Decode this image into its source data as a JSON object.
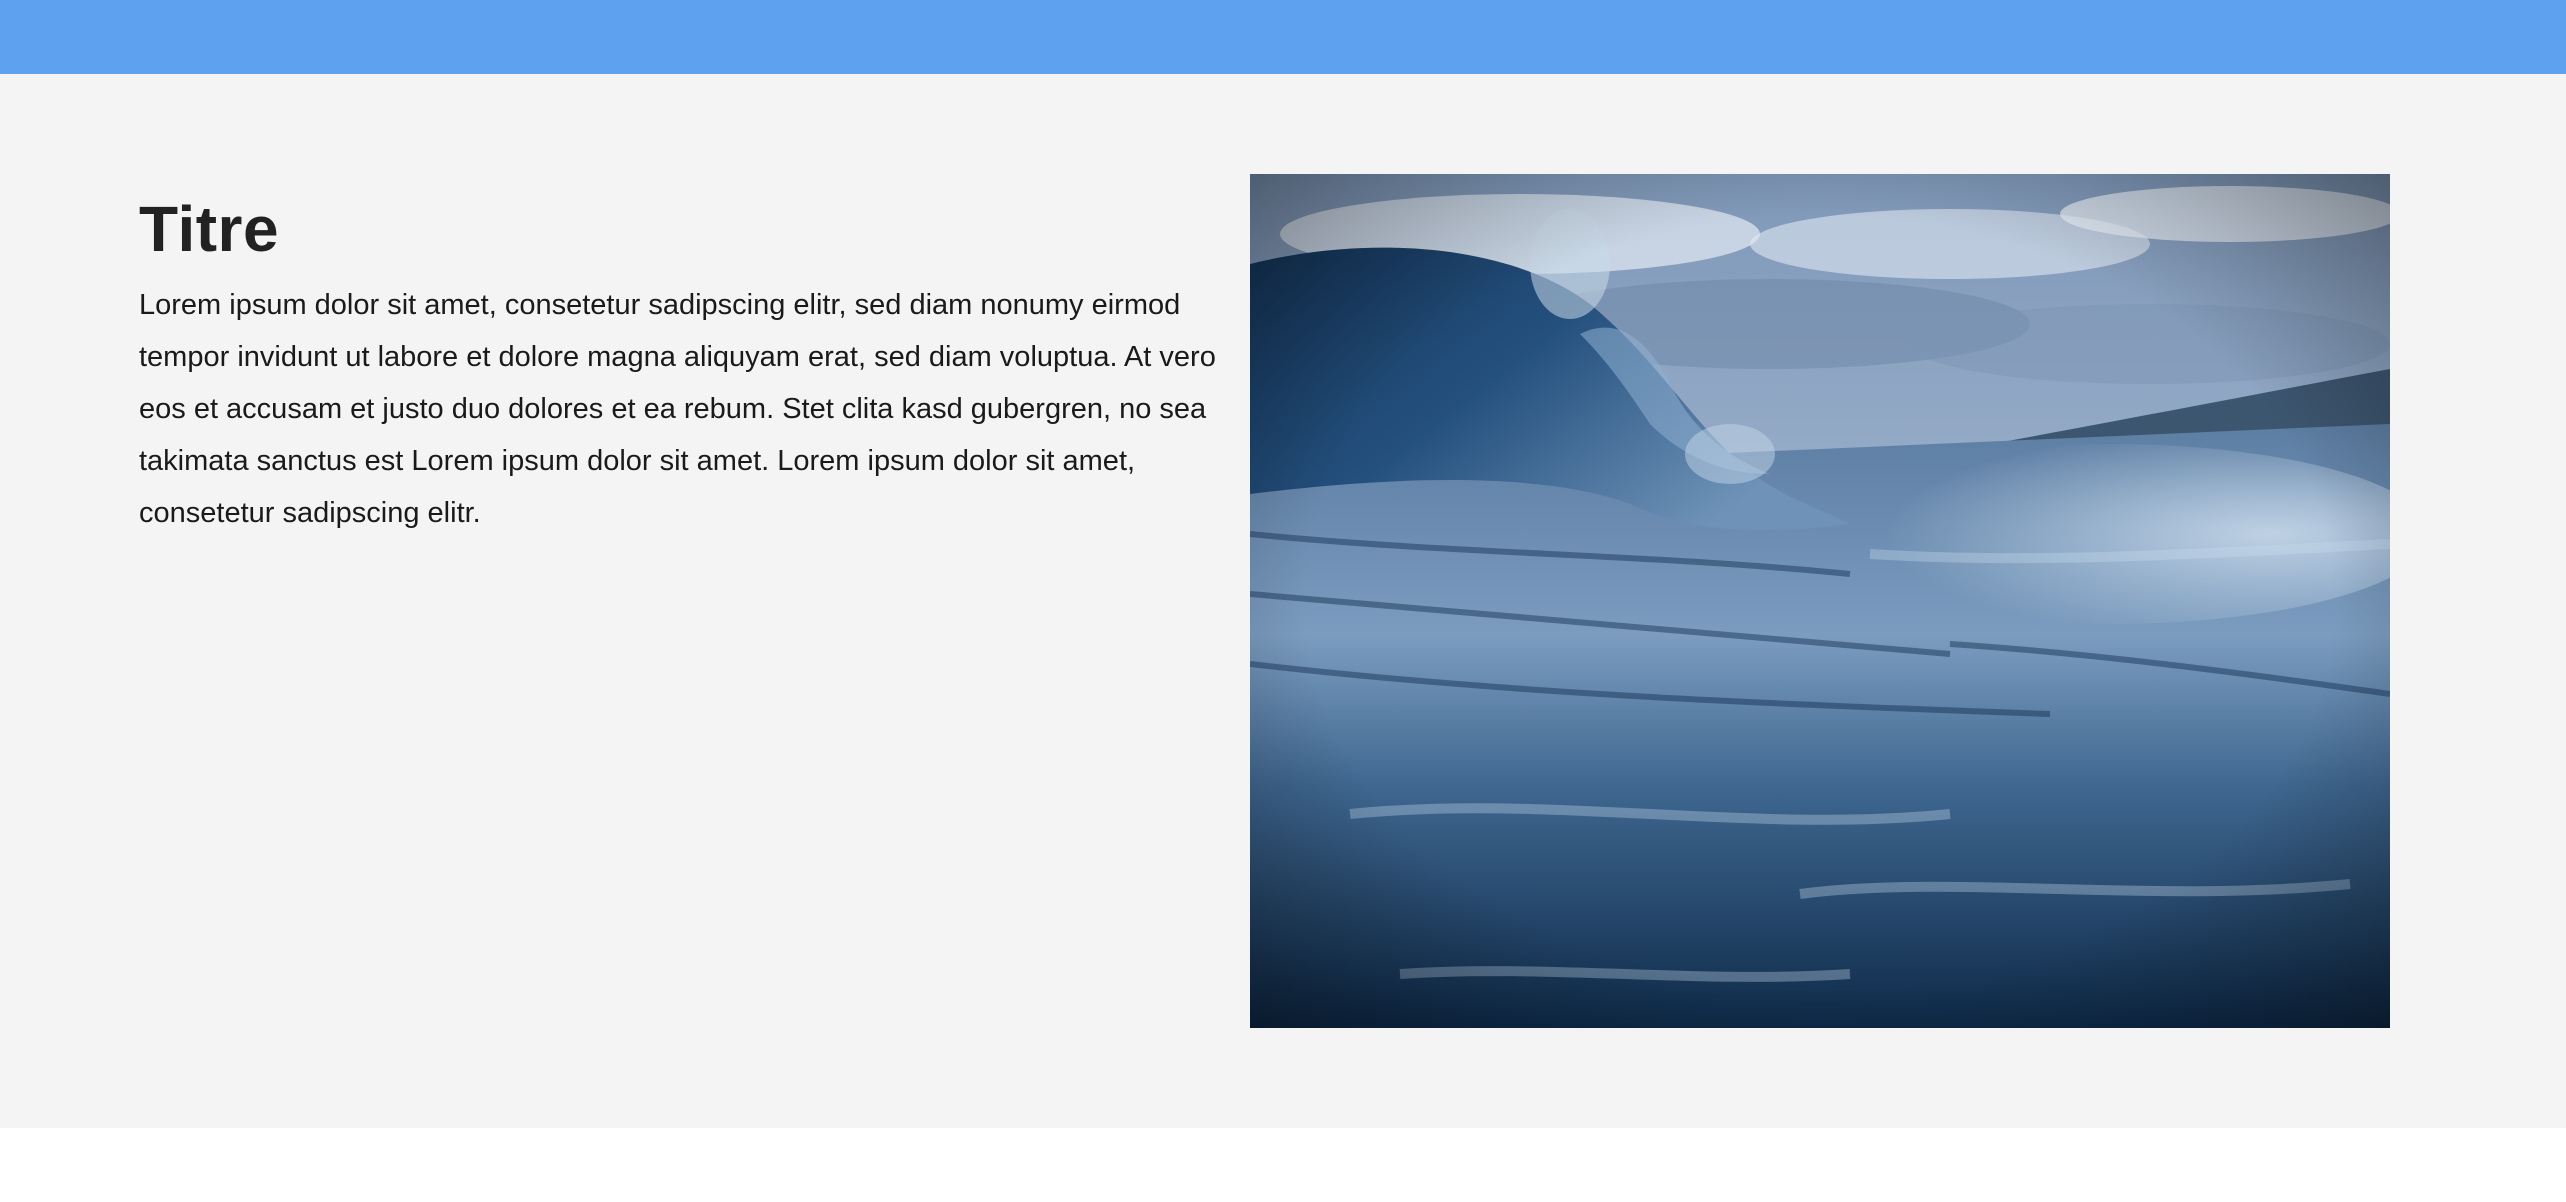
{
  "header": {
    "background_color": "#5ea1ee"
  },
  "content": {
    "title": "Titre",
    "paragraph": "Lorem ipsum dolor sit amet, consetetur sadipscing elitr, sed diam nonumy eirmod tempor invidunt ut labore et dolore magna aliquyam erat, sed diam voluptua. At vero eos et accusam et justo duo dolores et ea rebum. Stet clita kasd gubergren, no sea takimata sanctus est Lorem ipsum dolor sit amet. Lorem ipsum dolor sit amet, consetetur sadipscing elitr.",
    "background_color": "#f4f4f4"
  },
  "image": {
    "subject": "ocean-wave-photo"
  }
}
